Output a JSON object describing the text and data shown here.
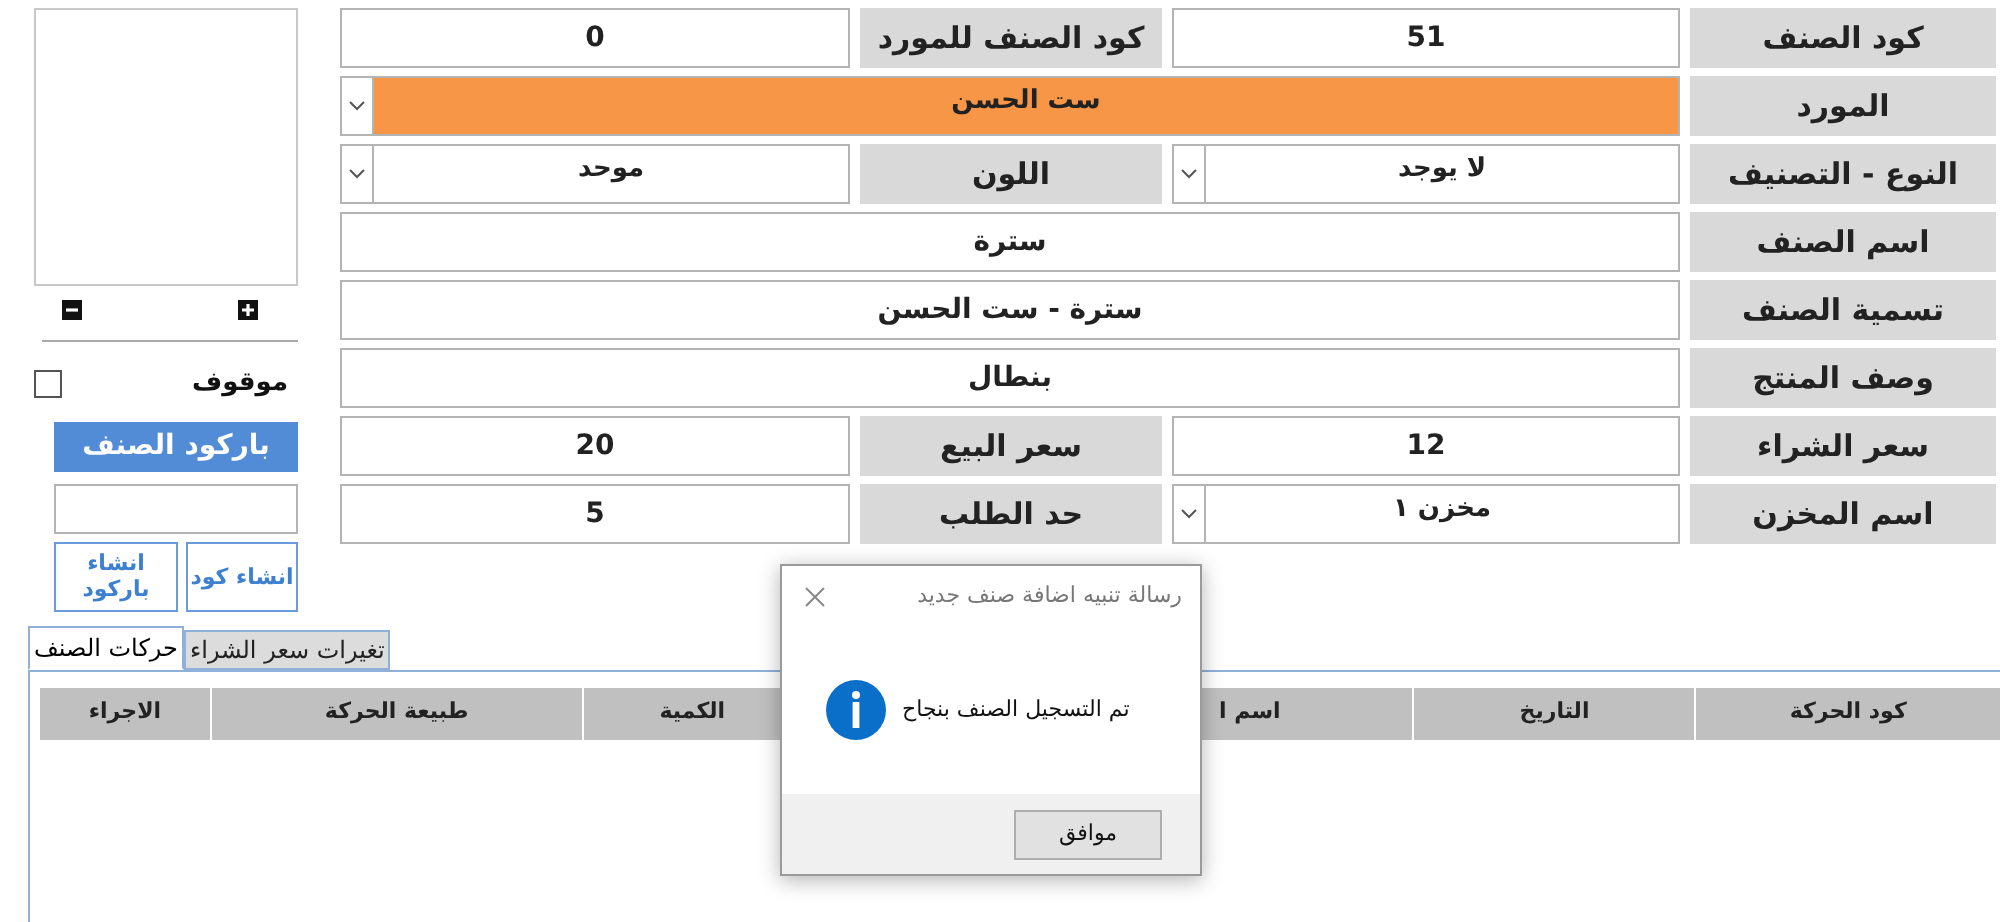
{
  "form": {
    "rows": [
      {
        "items": [
          {
            "kind": "label",
            "text": "كود الصنف"
          },
          {
            "kind": "input",
            "value": "51"
          },
          {
            "kind": "label",
            "text": "كود الصنف للمورد"
          },
          {
            "kind": "input",
            "value": "0"
          }
        ]
      },
      {
        "items": [
          {
            "kind": "label",
            "text": "المورد"
          },
          {
            "kind": "select",
            "value": "ست الحسن",
            "wide": true,
            "highlighted": true
          }
        ]
      },
      {
        "items": [
          {
            "kind": "label",
            "text": "النوع - التصنيف"
          },
          {
            "kind": "select",
            "value": "لا يوجد",
            "highlighted": false
          },
          {
            "kind": "label",
            "text": "اللون"
          },
          {
            "kind": "select",
            "value": "موحد",
            "highlighted": false
          }
        ]
      },
      {
        "items": [
          {
            "kind": "label",
            "text": "اسم الصنف"
          },
          {
            "kind": "input",
            "value": "سترة",
            "wide": true
          }
        ]
      },
      {
        "items": [
          {
            "kind": "label",
            "text": "تسمية الصنف"
          },
          {
            "kind": "input",
            "value": "سترة - ست الحسن",
            "wide": true
          }
        ]
      },
      {
        "items": [
          {
            "kind": "label",
            "text": "وصف المنتج"
          },
          {
            "kind": "input",
            "value": "بنطال",
            "wide": true
          }
        ]
      },
      {
        "items": [
          {
            "kind": "label",
            "text": "سعر الشراء"
          },
          {
            "kind": "input",
            "value": "12"
          },
          {
            "kind": "label",
            "text": "سعر البيع"
          },
          {
            "kind": "input",
            "value": "20"
          }
        ]
      },
      {
        "items": [
          {
            "kind": "label",
            "text": "اسم المخزن"
          },
          {
            "kind": "select",
            "value": "مخزن ١",
            "highlighted": false
          },
          {
            "kind": "label",
            "text": "حد الطلب"
          },
          {
            "kind": "input",
            "value": "5"
          }
        ]
      }
    ]
  },
  "side_panel": {
    "stopped": {
      "label": "موقوف",
      "checked": false
    },
    "barcode_button": "باركود الصنف",
    "create_code_button": "انشاء كود",
    "create_barcode_button": "انشاء باركود"
  },
  "tabs": [
    {
      "label": "تغيرات سعر الشراء",
      "selected": false
    },
    {
      "label": "حركات الصنف",
      "selected": true
    }
  ],
  "table": {
    "columns": [
      "كود الحركة",
      "التاريخ",
      "اسم ا",
      "الكمية",
      "طبيعة الحركة",
      "الاجراء"
    ]
  },
  "dialog": {
    "title": "رسالة تنبيه اضافة صنف جديد",
    "message": "تم التسجيل الصنف بنجاح",
    "button": "موافق"
  }
}
